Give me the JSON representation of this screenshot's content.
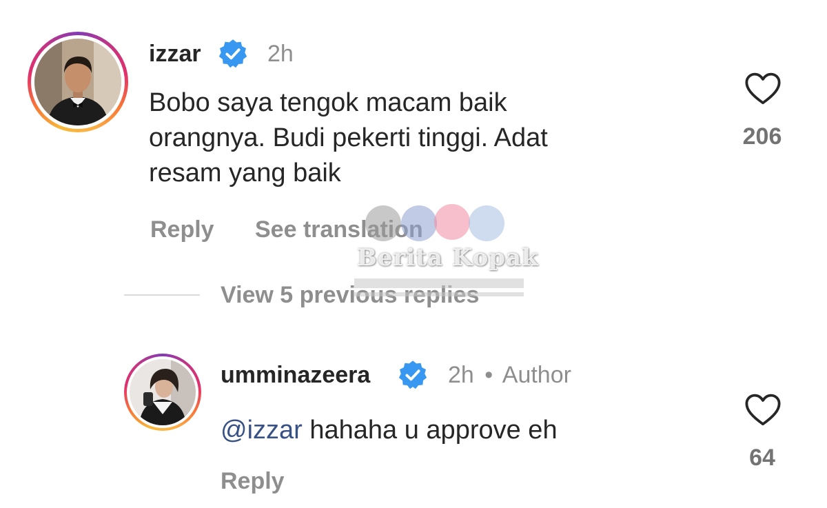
{
  "colors": {
    "verified": "#3897f0",
    "mention": "#385185",
    "secondary": "#8e8e8e",
    "primary_text": "#262626",
    "divider": "#dbdbdb"
  },
  "comment": {
    "username": "izzar",
    "time": "2h",
    "text_lines": [
      "Bobo saya tengok macam baik",
      "orangnya. Budi pekerti tinggi. Adat",
      "resam yang baik"
    ],
    "reply_label": "Reply",
    "see_translation_label": "See translation",
    "likes": "206",
    "verified_icon": "verified-badge-icon",
    "like_icon": "heart-outline-icon"
  },
  "view_replies_label": "View 5 previous replies",
  "reply": {
    "username": "umminazeera",
    "time": "2h",
    "separator": "•",
    "author_label": "Author",
    "mention": "@izzar",
    "text": "hahaha u approve eh",
    "reply_label": "Reply",
    "likes": "64",
    "verified_icon": "verified-badge-icon",
    "like_icon": "heart-outline-icon"
  },
  "watermark": {
    "text": "Berita Kopak",
    "icons": [
      "youtube-icon",
      "facebook-icon",
      "instagram-icon",
      "globe-icon"
    ]
  }
}
